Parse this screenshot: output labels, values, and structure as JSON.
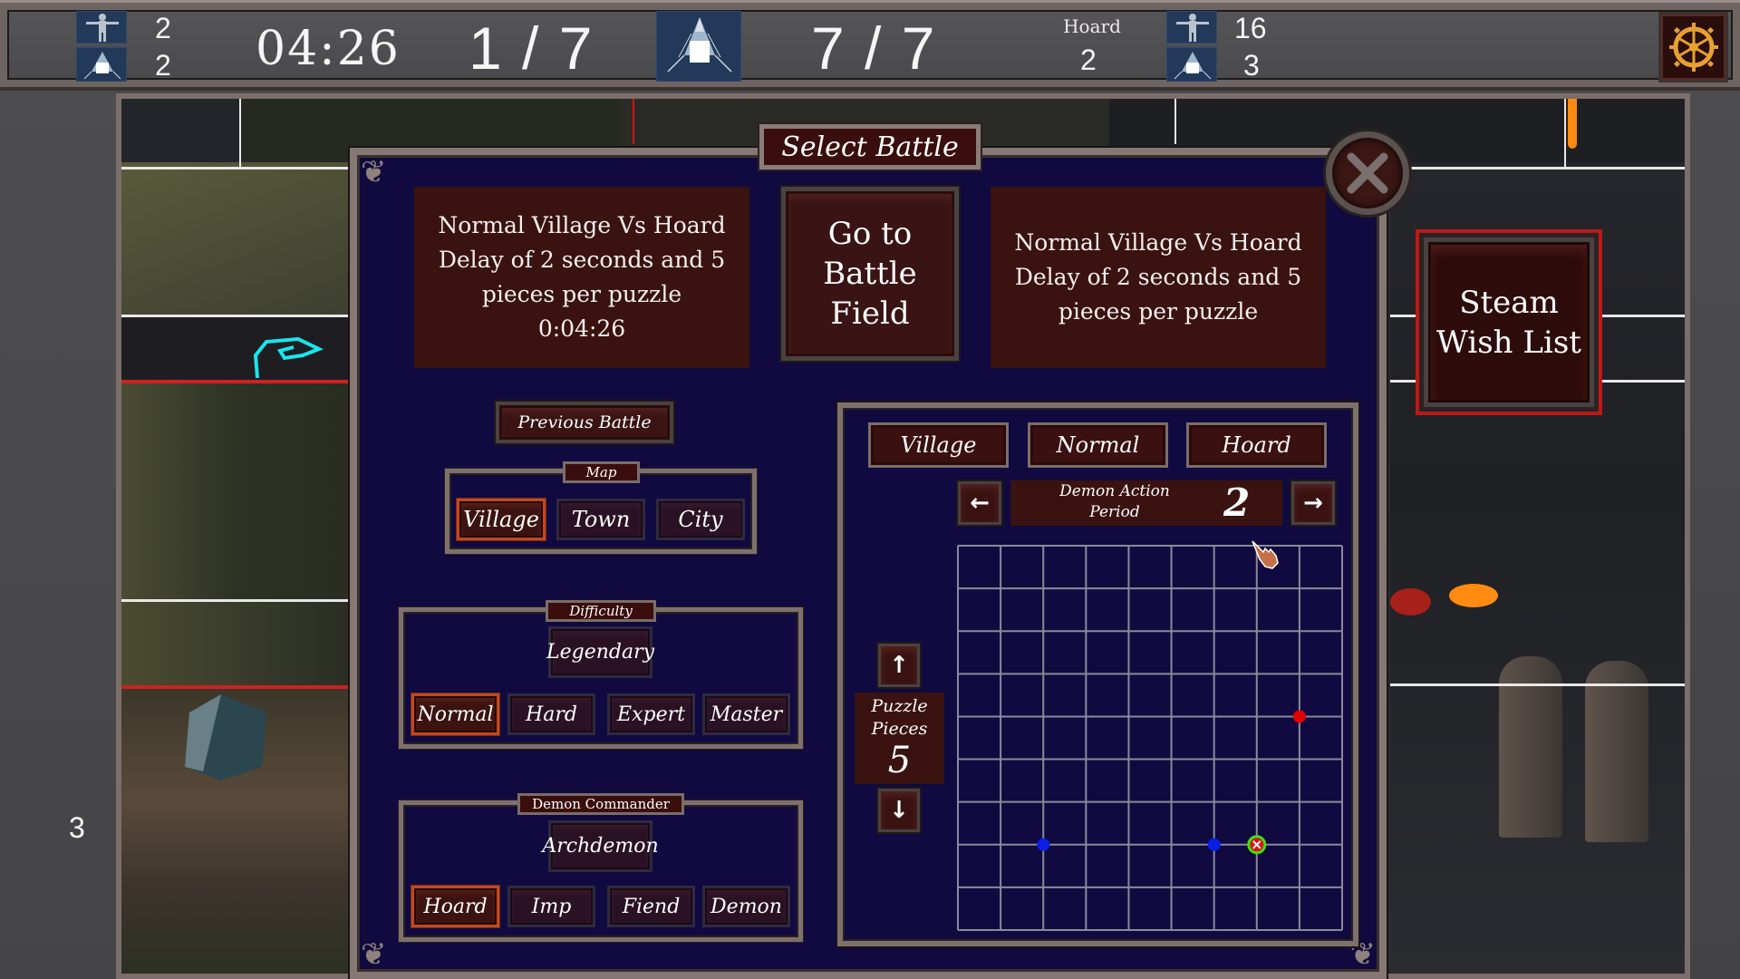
{
  "hud": {
    "left_units": {
      "soldier_count": "2",
      "tent_count": "2"
    },
    "timer": "04:26",
    "wave_progress": "1 / 7",
    "tent_progress": "7 / 7",
    "enemy_label": "Hoard",
    "enemy_value": "2",
    "right_units": {
      "soldier_count": "16",
      "tent_count": "3"
    },
    "icons": {
      "soldier": "soldier-icon",
      "tent": "tent-icon",
      "settings": "gear-icon"
    }
  },
  "side_number": "3",
  "modal": {
    "title": "Select Battle",
    "close_icon": "close-icon",
    "current_battle": {
      "line1": "Normal Village Vs Hoard",
      "line2": "Delay of 2 seconds and 5",
      "line3": "pieces per puzzle",
      "time": "0:04:26"
    },
    "go_button": {
      "line1": "Go to",
      "line2": "Battle Field"
    },
    "selected_battle": {
      "line1": "Normal Village Vs Hoard",
      "line2": "Delay of 2 seconds and 5",
      "line3": "pieces per puzzle"
    },
    "previous_battle_label": "Previous Battle",
    "map_group": {
      "label": "Map",
      "options": [
        "Village",
        "Town",
        "City"
      ],
      "selected": "Village"
    },
    "difficulty_group": {
      "label": "Difficulty",
      "top_option": "Legendary",
      "options": [
        "Normal",
        "Hard",
        "Expert",
        "Master"
      ],
      "selected": "Normal"
    },
    "commander_group": {
      "label": "Demon Commander",
      "top_option": "Archdemon",
      "options": [
        "Hoard",
        "Imp",
        "Fiend",
        "Demon"
      ],
      "selected": "Hoard"
    },
    "preview": {
      "tags": [
        "Village",
        "Normal",
        "Hoard"
      ],
      "demon_action_period": {
        "label_line1": "Demon Action",
        "label_line2": "Period",
        "value": "2"
      },
      "puzzle_pieces": {
        "label_line1": "Puzzle",
        "label_line2": "Pieces",
        "value": "5"
      },
      "grid": {
        "columns": 9,
        "rows": 9,
        "markers": [
          {
            "type": "red-dot",
            "col": 8,
            "row": 4,
            "color": "#e00000"
          },
          {
            "type": "blue-dot",
            "col": 2,
            "row": 7,
            "color": "#0a1ee6"
          },
          {
            "type": "blue-dot",
            "col": 6,
            "row": 7,
            "color": "#0a1ee6"
          },
          {
            "type": "target-x",
            "col": 7,
            "row": 7,
            "color": "#e01010",
            "ring": "#3ee014"
          }
        ]
      }
    }
  },
  "steam_button": {
    "line1": "Steam",
    "line2": "Wish List"
  },
  "colors": {
    "modal_bg": "#100a40",
    "button_maroon": "#3a1210",
    "selected_border": "#c2491f",
    "steam_border": "#c01818",
    "grid_line": "#8a8a98"
  }
}
